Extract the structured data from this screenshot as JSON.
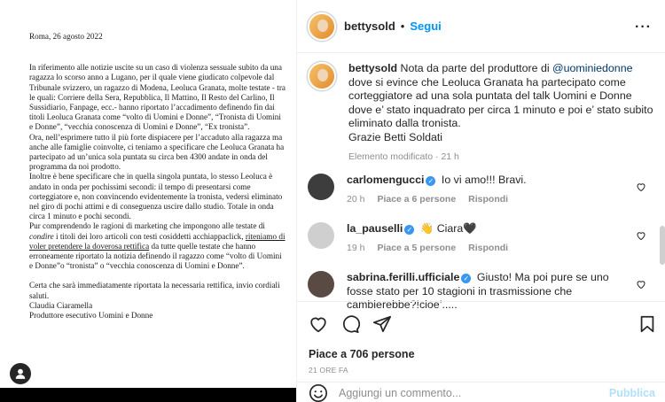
{
  "document": {
    "date": "Roma, 26 agosto 2022",
    "p1": "In riferimento alle notizie uscite su un caso di violenza sessuale subito da una ragazza lo scorso anno a Lugano, per il quale viene giudicato colpevole dal Tribunale svizzero, un ragazzo di Modena, Leoluca Granata, molte testate - tra le quali: Corriere della Sera, Repubblica, Il Mattino, Il Resto del Carlino, Il Sussidiario, Fanpage, ecc.- hanno riportato l’accadimento definendo fin dai titoli Leoluca Granata come “volto di Uomini e Donne”, “Tronista di Uomini e Donne”, “vecchia conoscenza di Uomini e Donne”, “Ex tronista”.",
    "p2": "Ora, nell’esprimere tutto il più forte dispiacere per l’accaduto alla ragazza ma anche alle famiglie coinvolte, ci teniamo a specificare che Leoluca Granata ha partecipato ad un’unica sola puntata su circa ben 4300 andate in onda del programma da noi prodotto.",
    "p3": "Inoltre è bene specificare che in quella singola puntata, lo stesso Leoluca è andato in onda per pochissimi secondi: il tempo di presentarsi come corteggiatore e, non convincendo evidentemente la tronista, vedersi eliminato nel giro di pochi attimi e di conseguenza uscire dallo studio. Totale in onda circa 1 minuto e pochi secondi.",
    "p4a": "Pur comprendendo le ragioni di marketing che impongono alle testate di ",
    "p4b": "condire",
    "p4c": " i titoli dei loro articoli con testi cosiddetti acchiappaclick, ",
    "p4d": "riteniamo di voler pretendere la doverosa rettifica",
    "p4e": " da tutte quelle testate che hanno erroneamente riportato la notizia definendo il ragazzo come “volto di Uomini e Donne”o “tronista” o “vecchia conoscenza di Uomini e Donne”.",
    "p5": "Certa che sarà immediatamente riportata la necessaria rettifica, invio cordiali saluti.",
    "sign1": "Claudia Ciaramella",
    "sign2": "Produttore esecutivo Uomini e Donne"
  },
  "header": {
    "username": "bettysold",
    "separator": "•",
    "follow_label": "Segui",
    "more_label": "···"
  },
  "caption": {
    "username": "bettysold",
    "text_a": " Nota da parte del produttore di ",
    "mention": "@uominiedonne",
    "text_b": " dove si evince che Leoluca Granata ha partecipato come corteggiatore ad una sola puntata del talk Uomini e Donne dove e’ stato inquadrato per circa 1 minuto e poi e’ stato subito eliminato dalla tronista.",
    "signoff": "Grazie Betti Soldati",
    "meta": "Elemento modificato · 21 h"
  },
  "comments": [
    {
      "username": "carlomengucci",
      "text": " Io vi amo!!! Bravi.",
      "time": "20 h",
      "likes": "Piace a 6 persone",
      "reply": "Rispondi"
    },
    {
      "username": "la_pauselli",
      "text": " 👋 Ciara🖤",
      "time": "19 h",
      "likes": "Piace a 5 persone",
      "reply": "Rispondi"
    },
    {
      "username": "sabrina.ferilli.ufficiale",
      "text": " Giusto! Ma poi pure se uno fosse stato per 10 stagioni in trasmissione che cambierebbe?!cioe’.....",
      "time": "",
      "likes": "",
      "reply": ""
    }
  ],
  "post": {
    "likes": "Piace a 706 persone",
    "time": "21 ORE FA"
  },
  "composer": {
    "placeholder": "Aggiungi un commento...",
    "publish_label": "Pubblica"
  },
  "colors": {
    "link_blue": "#0095f6",
    "verified_blue": "#3897f0",
    "mention": "#00376b"
  }
}
